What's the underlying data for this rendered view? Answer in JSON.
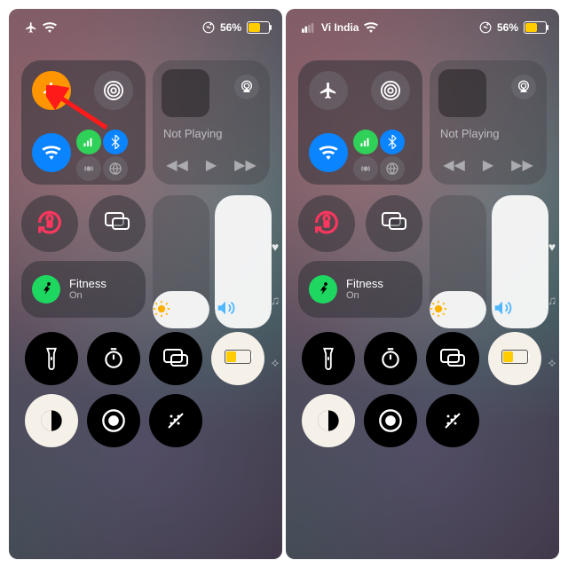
{
  "panels": {
    "left": {
      "status": {
        "carrier": "",
        "airplane_mode": true,
        "wifi": true,
        "activity_icon": "figure-run-icon",
        "battery_percent": "56%",
        "battery_fill_pct": 56,
        "battery_color": "#ffcc00"
      },
      "connectivity": {
        "airplane": {
          "state": "on",
          "bg": "#ff9500"
        },
        "airdrop": {
          "state": "off"
        },
        "wifi": {
          "state": "on",
          "bg": "#0a84ff"
        },
        "cellular": {
          "state": "on",
          "bg": "#30d158"
        },
        "bluetooth": {
          "state": "on",
          "bg": "#0a84ff"
        },
        "hotspot": {
          "state": "off"
        },
        "vpn": {
          "state": "off"
        }
      },
      "media": {
        "now_playing_label": "Not Playing",
        "airplay_icon": "airplay-icon"
      },
      "orientation_lock": {
        "state": "on",
        "color": "#ff375f"
      },
      "screen_mirroring": {
        "state": "available"
      },
      "brightness": {
        "fill_pct": 28
      },
      "volume": {
        "fill_pct": 100,
        "color": "#4fb7ff"
      },
      "fitness": {
        "title": "Fitness",
        "subtitle": "On"
      },
      "row_icons": [
        "flashlight",
        "timer",
        "screen-mirror",
        "low-power-mode"
      ],
      "low_power_mode_on": true,
      "row2_icons": [
        "dark-mode",
        "screen-record",
        "hearing"
      ],
      "dark_mode_on": true,
      "side_tabs": [
        "heart",
        "music",
        "antenna"
      ],
      "annotation_arrow": true
    },
    "right": {
      "status": {
        "carrier": "Vi India",
        "signal_bars": 2,
        "wifi": true,
        "activity_icon": "figure-run-icon",
        "battery_percent": "56%",
        "battery_fill_pct": 56,
        "battery_color": "#ffcc00"
      },
      "connectivity": {
        "airplane": {
          "state": "off"
        },
        "airdrop": {
          "state": "off"
        },
        "wifi": {
          "state": "on",
          "bg": "#0a84ff"
        },
        "cellular": {
          "state": "on",
          "bg": "#30d158"
        },
        "bluetooth": {
          "state": "on",
          "bg": "#0a84ff"
        },
        "hotspot": {
          "state": "off"
        },
        "vpn": {
          "state": "off"
        }
      },
      "media": {
        "now_playing_label": "Not Playing",
        "airplay_icon": "airplay-icon"
      },
      "orientation_lock": {
        "state": "on",
        "color": "#ff375f"
      },
      "screen_mirroring": {
        "state": "available"
      },
      "brightness": {
        "fill_pct": 28
      },
      "volume": {
        "fill_pct": 100,
        "color": "#4fb7ff"
      },
      "fitness": {
        "title": "Fitness",
        "subtitle": "On"
      },
      "row_icons": [
        "flashlight",
        "timer",
        "screen-mirror",
        "low-power-mode"
      ],
      "low_power_mode_on": true,
      "row2_icons": [
        "dark-mode",
        "screen-record",
        "hearing"
      ],
      "dark_mode_on": true,
      "side_tabs": [
        "heart",
        "music",
        "antenna"
      ]
    }
  }
}
